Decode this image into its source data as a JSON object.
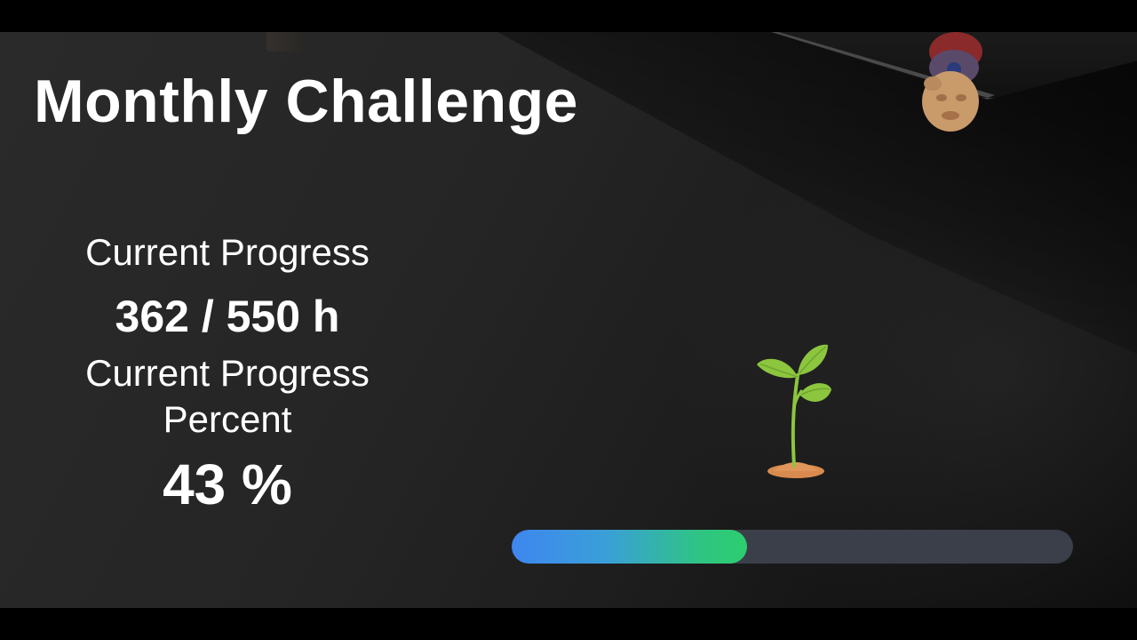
{
  "title": "Monthly Challenge",
  "progress": {
    "hours_label": "Current Progress",
    "hours_value": "362 / 550 h",
    "percent_label_line1": "Current Progress",
    "percent_label_line2": "Percent",
    "percent_value": "43 %",
    "fill_fraction": 0.42
  },
  "icons": {
    "plant": "seedling-icon"
  },
  "colors": {
    "bar_start": "#3e86ef",
    "bar_end": "#2ccf6e",
    "bar_track": "#3a3f4a",
    "text": "#ffffff"
  }
}
